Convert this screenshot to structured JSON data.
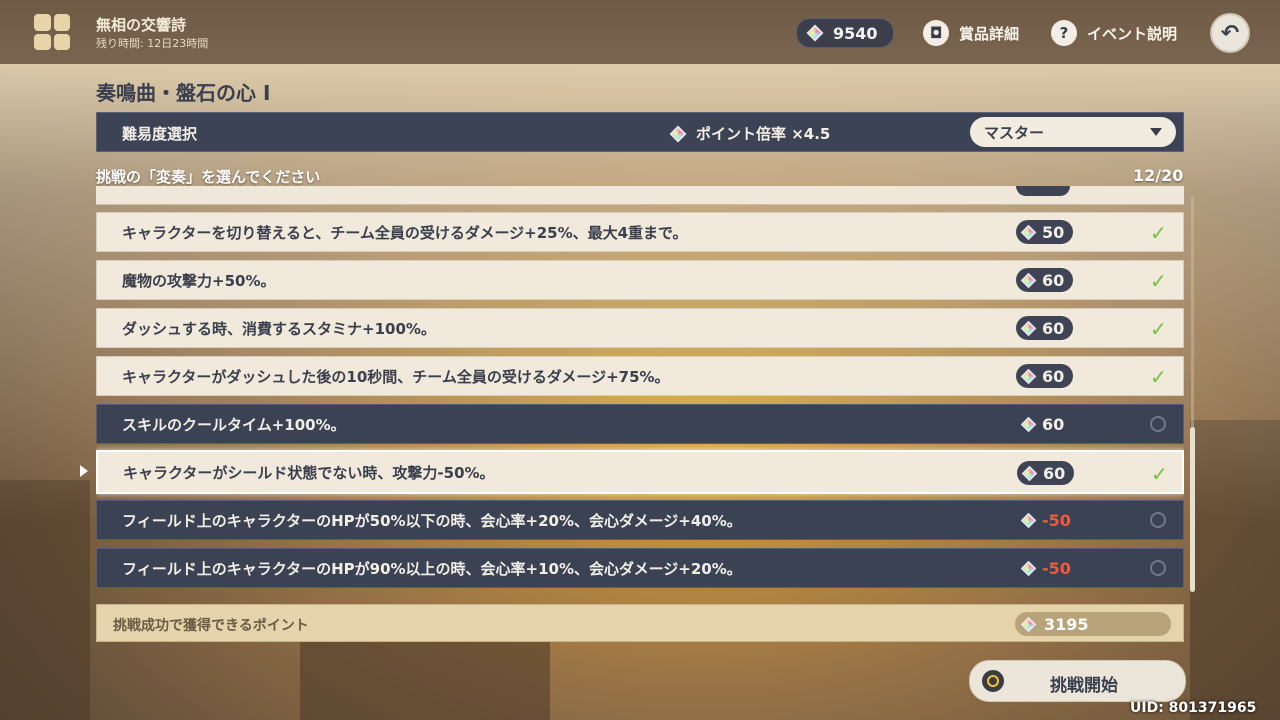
{
  "header": {
    "title": "無相の交響詩",
    "subtitle": "残り時間: 12日23時間",
    "currency_value": "9540",
    "rewards_label": "賞品詳細",
    "event_info_label": "イベント説明",
    "event_info_icon_glyph": "?",
    "rewards_icon_glyph": "◘",
    "back_icon_glyph": "↶"
  },
  "section": {
    "title": "奏鳴曲・盤石の心 I"
  },
  "difficulty": {
    "label": "難易度選択",
    "multiplier": "ポイント倍率 ×4.5",
    "selected": "マスター"
  },
  "list": {
    "prompt": "挑戦の「変奏」を選んでください",
    "counter": "12/20",
    "items": [
      {
        "text": "キャラクターを切り替えると、チーム全員の受けるダメージ+25%、最大4重まで。",
        "cost": "50",
        "selected": true
      },
      {
        "text": "魔物の攻撃力+50%。",
        "cost": "60",
        "selected": true
      },
      {
        "text": "ダッシュする時、消費するスタミナ+100%。",
        "cost": "60",
        "selected": true
      },
      {
        "text": "キャラクターがダッシュした後の10秒間、チーム全員の受けるダメージ+75%。",
        "cost": "60",
        "selected": true
      },
      {
        "text": "スキルのクールタイム+100%。",
        "cost": "60",
        "selected": false
      },
      {
        "text": "キャラクターがシールド状態でない時、攻撃力-50%。",
        "cost": "60",
        "selected": true
      },
      {
        "text": "フィールド上のキャラクターのHPが50%以下の時、会心率+20%、会心ダメージ+40%。",
        "cost": "-50",
        "selected": false
      },
      {
        "text": "フィールド上のキャラクターのHPが90%以上の時、会心率+10%、会心ダメージ+20%。",
        "cost": "-50",
        "selected": false
      }
    ],
    "check_glyph": "✓"
  },
  "points": {
    "label": "挑戦成功で獲得できるポイント",
    "value": "3195"
  },
  "start_button": {
    "label": "挑戦開始"
  },
  "uid": "UID: 801371965",
  "colors": {
    "check": "#72c23a",
    "negative_cost": "#f15a3a",
    "unselected_row": "#3a4254",
    "selected_row": "#f0e9dc"
  }
}
